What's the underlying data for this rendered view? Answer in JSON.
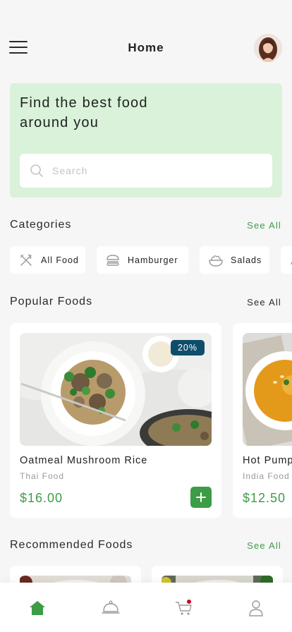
{
  "header": {
    "title": "Home",
    "menu_icon": "hamburger-menu-icon",
    "avatar": "user-avatar"
  },
  "hero": {
    "title_line1": "Find the best food",
    "title_line2": "around you",
    "search": {
      "placeholder": "Search",
      "value": "",
      "icon": "search-icon"
    }
  },
  "categories": {
    "title": "Categories",
    "see_all": "See All",
    "items": [
      {
        "label": "All Food",
        "icon": "fork-knife-icon"
      },
      {
        "label": "Hamburger",
        "icon": "burger-icon"
      },
      {
        "label": "Salads",
        "icon": "salad-bowl-icon"
      }
    ]
  },
  "popular": {
    "title": "Popular Foods",
    "see_all": "See All",
    "items": [
      {
        "name": "Oatmeal Mushroom Rice",
        "cuisine": "Thai Food",
        "price": "$16.00",
        "badge": "20%"
      },
      {
        "name": "Hot Pump",
        "cuisine": "India Food",
        "price": "$12.50"
      }
    ]
  },
  "recommended": {
    "title": "Recommended Foods",
    "see_all": "See All"
  },
  "bottom_nav": {
    "items": [
      {
        "name": "home",
        "icon": "home-icon",
        "active": true
      },
      {
        "name": "menu",
        "icon": "cloche-icon"
      },
      {
        "name": "cart",
        "icon": "cart-icon",
        "has_dot": true
      },
      {
        "name": "profile",
        "icon": "user-icon"
      }
    ]
  },
  "colors": {
    "accent_green": "#3d9c46",
    "hero_bg": "#d9f2d9",
    "badge_bg": "#0f4e6b",
    "background": "#f6f6f6",
    "notification_dot": "#d0021b"
  }
}
